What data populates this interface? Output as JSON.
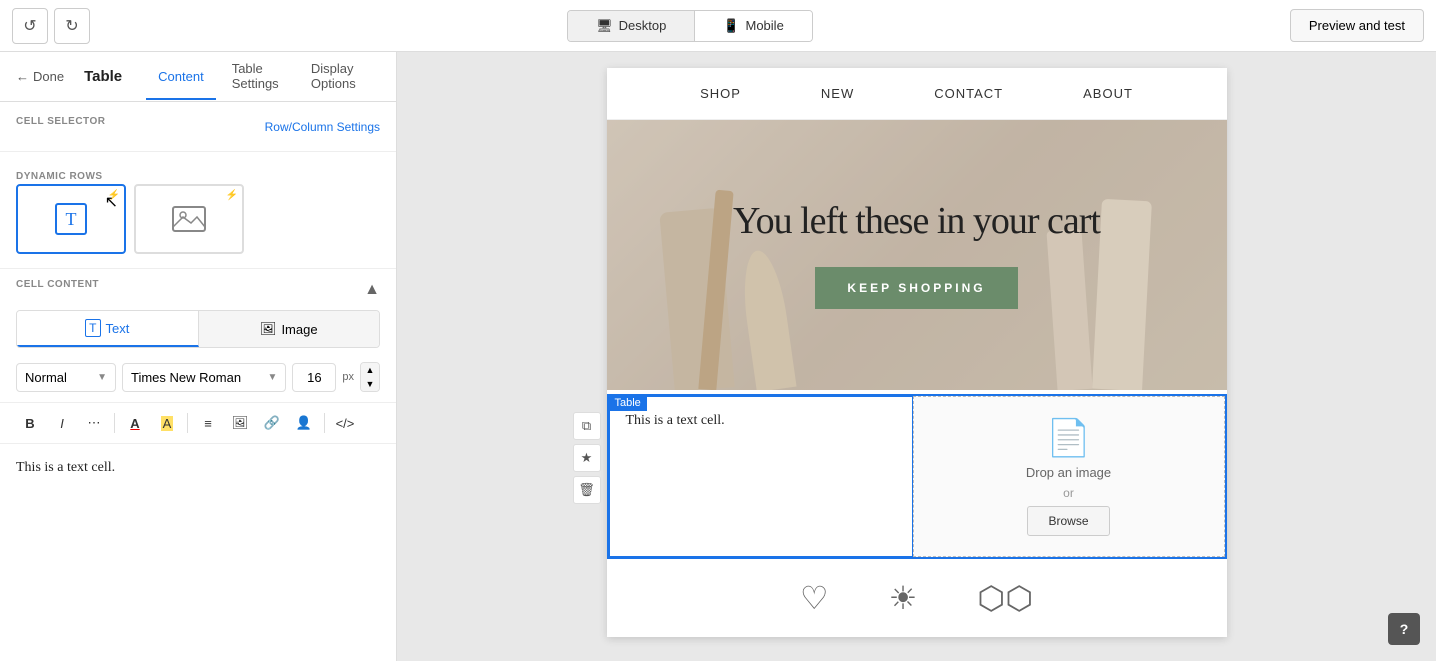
{
  "topbar": {
    "undo_icon": "↺",
    "redo_icon": "↻",
    "desktop_label": "Desktop",
    "mobile_label": "Mobile",
    "preview_btn": "Preview and test"
  },
  "panel": {
    "title": "Table",
    "back_label": "Done",
    "tabs": [
      "Content",
      "Table Settings",
      "Display Options"
    ],
    "active_tab": "Content",
    "cell_selector_label": "CELL SELECTOR",
    "row_column_link": "Row/Column Settings",
    "dynamic_rows_label": "DYNAMIC ROWS",
    "cell_content_label": "CELL CONTENT",
    "collapse_icon": "▲",
    "text_tab": "Text",
    "image_tab": "Image",
    "font_style": "Normal",
    "font_name": "Times New Roman",
    "font_size": "16",
    "font_size_unit": "px",
    "editor_content": "This is a text cell.",
    "rich_toolbar": {
      "bold": "B",
      "italic": "I",
      "more": "⋯",
      "text_color": "A",
      "text_bg": "A",
      "align": "≡",
      "image": "🖼",
      "link": "🔗",
      "person": "👤",
      "code": "</>",
      "divider1": true,
      "divider2": true,
      "divider3": true
    }
  },
  "email": {
    "nav": {
      "items": [
        "SHOP",
        "NEW",
        "CONTACT",
        "ABOUT"
      ]
    },
    "hero": {
      "title": "You left these in your cart",
      "button": "KEEP SHOPPING"
    },
    "table": {
      "label": "Table",
      "cell_text": "This is a text cell.",
      "cell_image_drop": "Drop an image",
      "cell_image_or": "or",
      "cell_image_browse": "Browse",
      "side_actions": [
        "copy",
        "favorite",
        "delete"
      ]
    },
    "footer_icons": [
      "♡",
      "☀",
      "⬡⬡"
    ]
  },
  "help": {
    "label": "?"
  }
}
